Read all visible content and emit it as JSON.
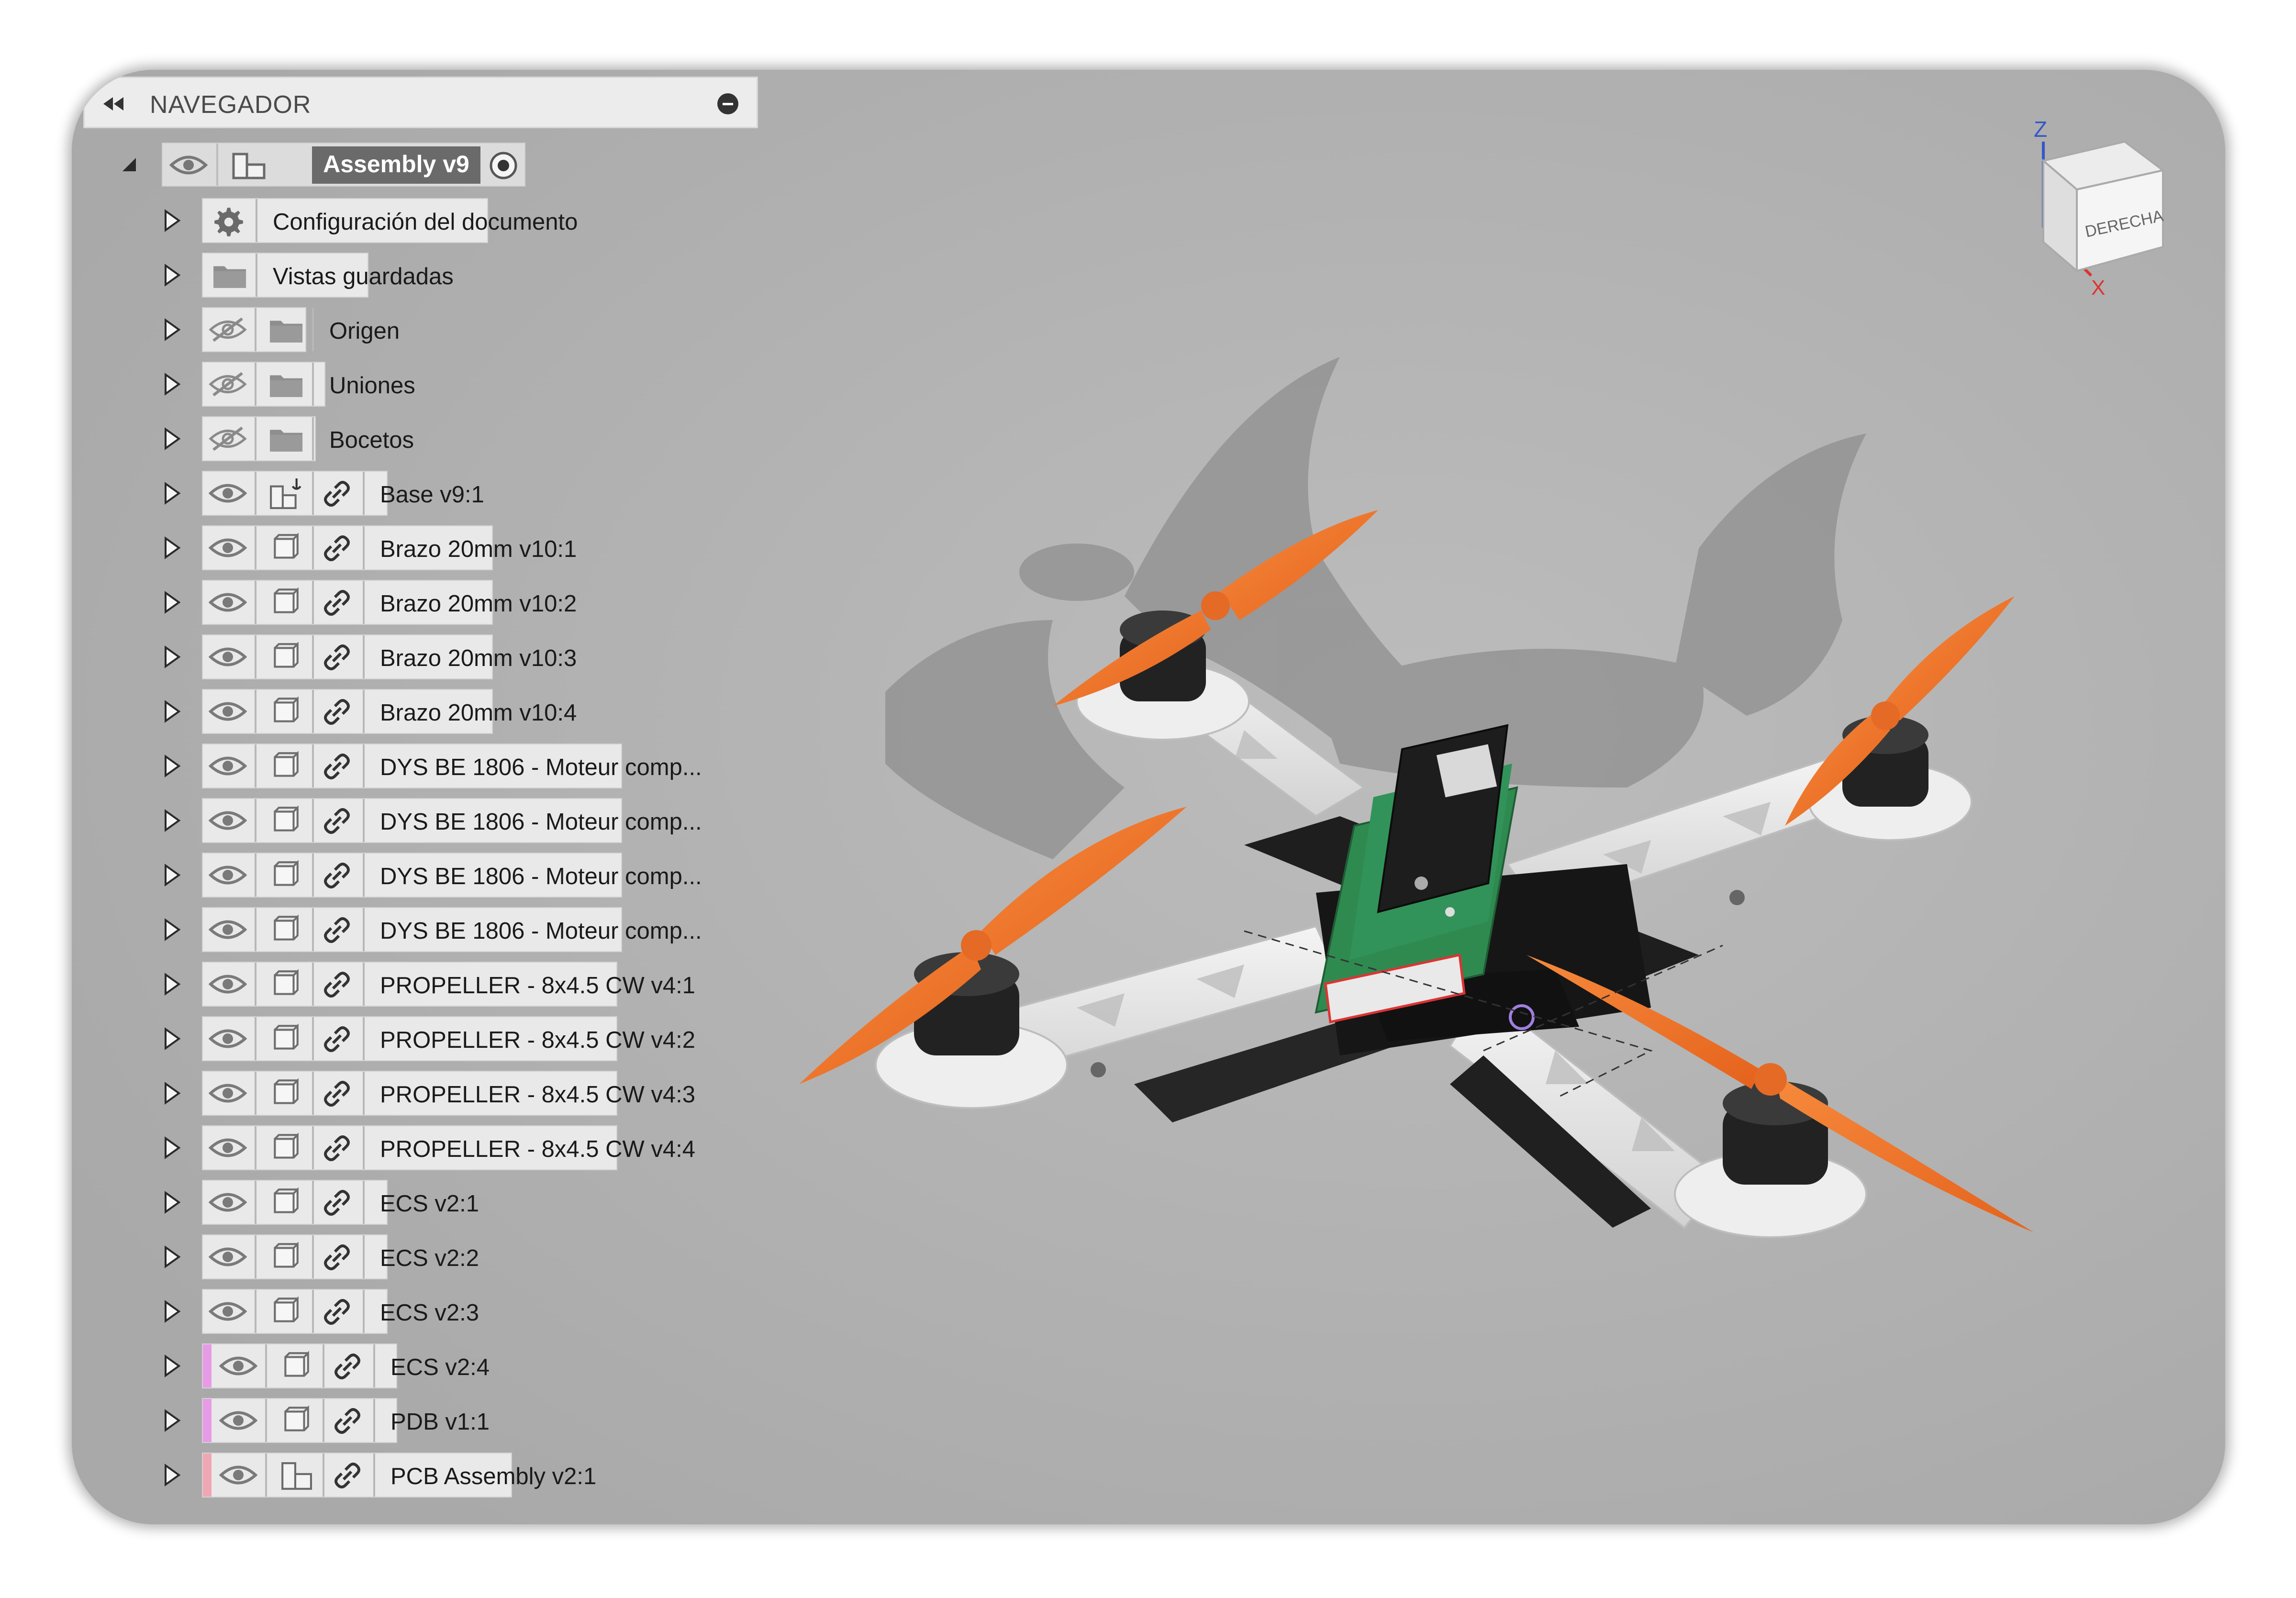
{
  "navigator": {
    "title": "NAVEGADOR",
    "root": {
      "label": "Assembly v9"
    },
    "items": [
      {
        "label": "Configuración del documento",
        "icon": "gear-icon",
        "eye": null,
        "link": false,
        "accent": null
      },
      {
        "label": "Vistas guardadas",
        "icon": "folder-icon",
        "eye": null,
        "link": false,
        "accent": null
      },
      {
        "label": "Origen",
        "icon": "folder-icon",
        "eye": "hidden",
        "link": false,
        "accent": null
      },
      {
        "label": "Uniones",
        "icon": "folder-icon",
        "eye": "hidden",
        "link": false,
        "accent": null
      },
      {
        "label": "Bocetos",
        "icon": "folder-icon",
        "eye": "hidden",
        "link": false,
        "accent": null
      },
      {
        "label": "Base v9:1",
        "icon": "grounded-assembly-icon",
        "eye": "visible",
        "link": true,
        "accent": null
      },
      {
        "label": "Brazo 20mm v10:1",
        "icon": "component-icon",
        "eye": "visible",
        "link": true,
        "accent": null
      },
      {
        "label": "Brazo 20mm v10:2",
        "icon": "component-icon",
        "eye": "visible",
        "link": true,
        "accent": null
      },
      {
        "label": "Brazo 20mm v10:3",
        "icon": "component-icon",
        "eye": "visible",
        "link": true,
        "accent": null
      },
      {
        "label": "Brazo 20mm v10:4",
        "icon": "component-icon",
        "eye": "visible",
        "link": true,
        "accent": null
      },
      {
        "label": "DYS BE 1806 - Moteur comp...",
        "icon": "component-icon",
        "eye": "visible",
        "link": true,
        "accent": null
      },
      {
        "label": "DYS BE 1806 - Moteur comp...",
        "icon": "component-icon",
        "eye": "visible",
        "link": true,
        "accent": null
      },
      {
        "label": "DYS BE 1806 - Moteur comp...",
        "icon": "component-icon",
        "eye": "visible",
        "link": true,
        "accent": null
      },
      {
        "label": "DYS BE 1806 - Moteur comp...",
        "icon": "component-icon",
        "eye": "visible",
        "link": true,
        "accent": null
      },
      {
        "label": "PROPELLER - 8x4.5 CW v4:1",
        "icon": "component-icon",
        "eye": "visible",
        "link": true,
        "accent": null
      },
      {
        "label": "PROPELLER - 8x4.5 CW v4:2",
        "icon": "component-icon",
        "eye": "visible",
        "link": true,
        "accent": null
      },
      {
        "label": "PROPELLER - 8x4.5 CW v4:3",
        "icon": "component-icon",
        "eye": "visible",
        "link": true,
        "accent": null
      },
      {
        "label": "PROPELLER - 8x4.5 CW v4:4",
        "icon": "component-icon",
        "eye": "visible",
        "link": true,
        "accent": null
      },
      {
        "label": "ECS v2:1",
        "icon": "component-icon",
        "eye": "visible",
        "link": true,
        "accent": null
      },
      {
        "label": "ECS v2:2",
        "icon": "component-icon",
        "eye": "visible",
        "link": true,
        "accent": null
      },
      {
        "label": "ECS v2:3",
        "icon": "component-icon",
        "eye": "visible",
        "link": true,
        "accent": null
      },
      {
        "label": "ECS v2:4",
        "icon": "component-icon",
        "eye": "visible",
        "link": true,
        "accent": "#e79be6"
      },
      {
        "label": "PDB v1:1",
        "icon": "component-icon",
        "eye": "visible",
        "link": true,
        "accent": "#e79be6"
      },
      {
        "label": "PCB Assembly v2:1",
        "icon": "assembly-icon",
        "eye": "visible",
        "link": true,
        "accent": "#f0a7b4"
      }
    ]
  },
  "viewcube": {
    "face_front": "DERECHA",
    "axis_z": "Z",
    "axis_x": "X"
  },
  "colors": {
    "viewport_bg": "#b4b4b4",
    "propeller": "#f07a30",
    "frame_white": "#ececec",
    "frame_black": "#1b1b1b",
    "pcb_green": "#2f8a50"
  }
}
